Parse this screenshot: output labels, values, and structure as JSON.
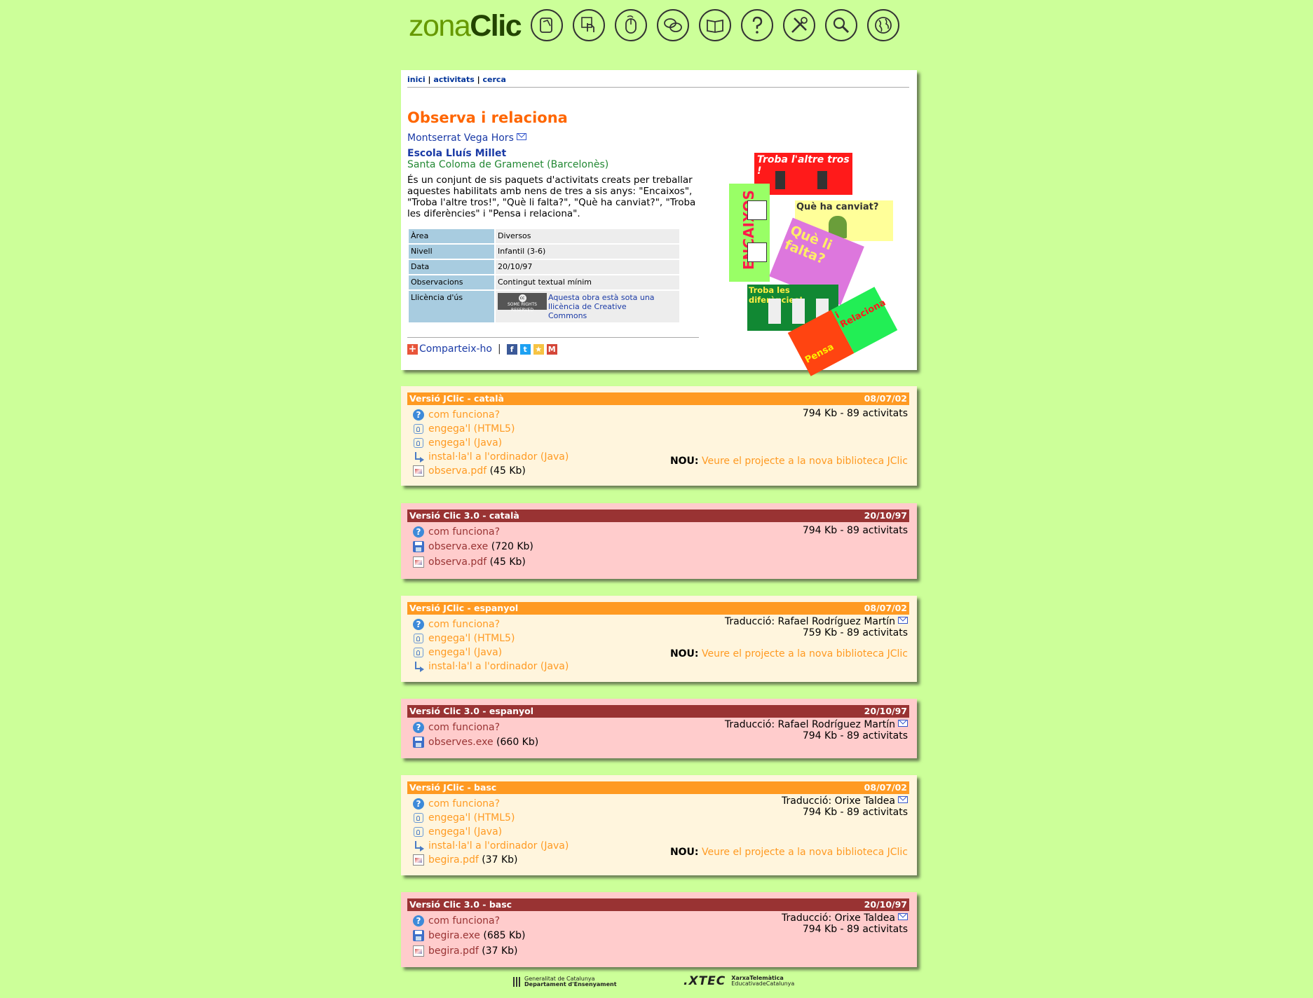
{
  "header": {
    "logo_light": "zona",
    "logo_bold": "Clic",
    "nav_icons": [
      "hand-pointer-icon",
      "touch-icon",
      "mouse-icon",
      "chat-bubbles-icon",
      "book-icon",
      "question-icon",
      "tools-icon",
      "search-icon",
      "globe-icon"
    ]
  },
  "breadcrumb": {
    "home": "inici",
    "activities": "activitats",
    "search": "cerca",
    "separator": "|"
  },
  "project": {
    "title": "Observa i relaciona",
    "author": "Montserrat Vega Hors",
    "school": "Escola Lluís Millet",
    "town": "Santa Coloma de Gramenet (Barcelonès)",
    "description": "És un conjunt de sis paquets d'activitats creats per treballar aquestes habilitats amb nens de tres a sis anys: \"Encaixos\", \"Troba l'altre tros!\", \"Què li falta?\", \"Què ha canviat?\", \"Troba les diferències\" i \"Pensa i relaciona\"."
  },
  "meta": [
    {
      "key": "Àrea",
      "value": "Diversos"
    },
    {
      "key": "Nivell",
      "value": "Infantil (3-6)"
    },
    {
      "key": "Data",
      "value": "20/10/97"
    },
    {
      "key": "Observacions",
      "value": "Contingut textual mínim"
    },
    {
      "key": "Llicència d'ús",
      "value": "Aquesta obra està sota una llicència de Creative Commons"
    }
  ],
  "cc_badge": {
    "symbol": "cc",
    "text": "SOME RIGHTS RESERVED"
  },
  "share": {
    "label": "Comparteix-ho",
    "networks": [
      "facebook-icon",
      "twitter-icon",
      "favorite-star-icon",
      "gmail-icon"
    ]
  },
  "collage": {
    "panels": [
      "Troba l'altre tros !",
      "Què ha canviat?",
      "ENCAIXOS",
      "Què li falta?",
      "Troba les diferències!",
      "Pensa",
      "i Relaciona"
    ]
  },
  "common": {
    "how": "com funciona?",
    "html5": "engega'l (HTML5)",
    "java": "engega'l (Java)",
    "install": "instal·la'l a l'ordinador (Java)",
    "nou": "NOU:",
    "library": "Veure el projecte a la nova biblioteca JClic",
    "translation_prefix": "Traducció:"
  },
  "versions": [
    {
      "title": "Versió JClic - català",
      "date": "08/07/02",
      "size": "794 Kb - 89 activitats",
      "pdf": "observa.pdf",
      "pdf_size": "(45 Kb)"
    },
    {
      "title": "Versió Clic 3.0 - català",
      "date": "20/10/97",
      "size": "794 Kb - 89 activitats",
      "exe": "observa.exe",
      "exe_size": "(720 Kb)",
      "pdf": "observa.pdf",
      "pdf_size": "(45 Kb)"
    },
    {
      "title": "Versió JClic - espanyol",
      "date": "08/07/02",
      "translator": "Rafael Rodríguez Martín",
      "size": "759 Kb - 89 activitats"
    },
    {
      "title": "Versió Clic 3.0 - espanyol",
      "date": "20/10/97",
      "translator": "Rafael Rodríguez Martín",
      "size": "794 Kb - 89 activitats",
      "exe": "observes.exe",
      "exe_size": "(660 Kb)"
    },
    {
      "title": "Versió JClic - basc",
      "date": "08/07/02",
      "translator": "Orixe Taldea",
      "size": "794 Kb - 89 activitats",
      "pdf": "begira.pdf",
      "pdf_size": "(37 Kb)"
    },
    {
      "title": "Versió Clic 3.0 - basc",
      "date": "20/10/97",
      "translator": "Orixe Taldea",
      "size": "794 Kb - 89 activitats",
      "exe": "begira.exe",
      "exe_size": "(685 Kb)",
      "pdf": "begira.pdf",
      "pdf_size": "(37 Kb)"
    }
  ],
  "footer": {
    "gen_line1": "Generalitat de Catalunya",
    "gen_line2": "Departament d'Ensenyament",
    "xtec": ".XTEC",
    "xtec_line1": "XarxaTelemàtica",
    "xtec_line2": "EducativadeCatalunya"
  },
  "colors": {
    "page_bg": "#ccff99",
    "title_orange": "#ff6600",
    "jclic_header": "#ff9a22",
    "jclic_bg": "#fff5dd",
    "clic_header": "#993333",
    "clic_bg": "#ffcccc",
    "link_blue": "#1a3aa6",
    "town_green": "#228833"
  }
}
